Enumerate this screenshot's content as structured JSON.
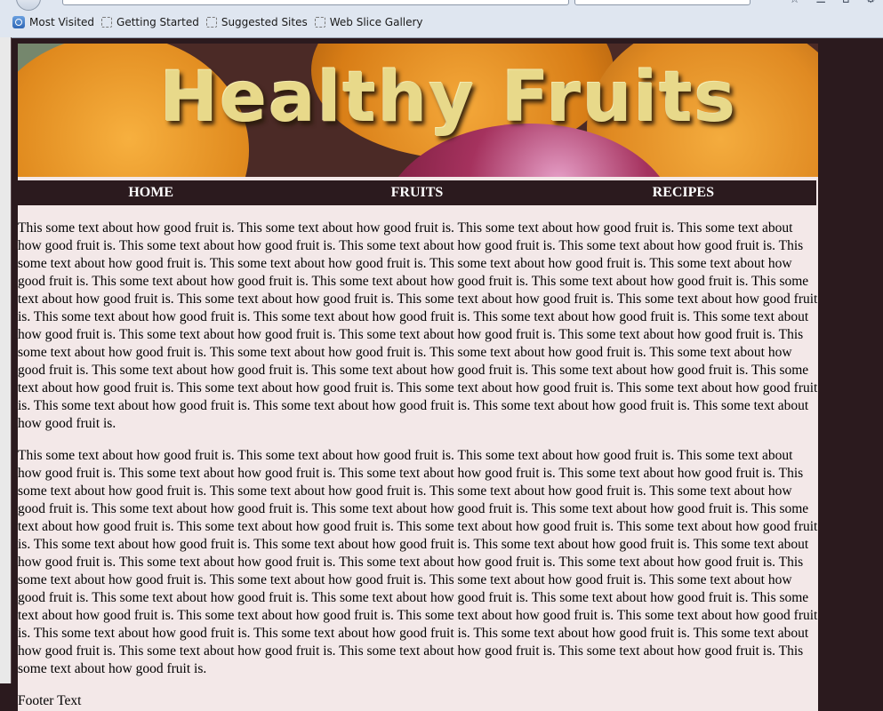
{
  "browser": {
    "bookmarks": [
      "Most Visited",
      "Getting Started",
      "Suggested Sites",
      "Web Slice Gallery"
    ]
  },
  "site": {
    "title": "Healthy Fruits",
    "nav": [
      "HOME",
      "FRUITS",
      "RECIPES"
    ],
    "paragraphs": [
      "This some text about how good fruit is. This some text about how good fruit is. This some text about how good fruit is. This some text about how good fruit is. This some text about how good fruit is. This some text about how good fruit is. This some text about how good fruit is. This some text about how good fruit is. This some text about how good fruit is. This some text about how good fruit is. This some text about how good fruit is. This some text about how good fruit is. This some text about how good fruit is. This some text about how good fruit is. This some text about how good fruit is. This some text about how good fruit is. This some text about how good fruit is. This some text about how good fruit is. This some text about how good fruit is. This some text about how good fruit is. This some text about how good fruit is. This some text about how good fruit is. This some text about how good fruit is. This some text about how good fruit is. This some text about how good fruit is. This some text about how good fruit is. This some text about how good fruit is. This some text about how good fruit is. This some text about how good fruit is. This some text about how good fruit is. This some text about how good fruit is. This some text about how good fruit is. This some text about how good fruit is. This some text about how good fruit is. This some text about how good fruit is. This some text about how good fruit is. This some text about how good fruit is. This some text about how good fruit is. This some text about how good fruit is. This some text about how good fruit is.",
      "This some text about how good fruit is. This some text about how good fruit is. This some text about how good fruit is. This some text about how good fruit is. This some text about how good fruit is. This some text about how good fruit is. This some text about how good fruit is. This some text about how good fruit is. This some text about how good fruit is. This some text about how good fruit is. This some text about how good fruit is. This some text about how good fruit is. This some text about how good fruit is. This some text about how good fruit is. This some text about how good fruit is. This some text about how good fruit is. This some text about how good fruit is. This some text about how good fruit is. This some text about how good fruit is. This some text about how good fruit is. This some text about how good fruit is. This some text about how good fruit is. This some text about how good fruit is. This some text about how good fruit is. This some text about how good fruit is. This some text about how good fruit is. This some text about how good fruit is. This some text about how good fruit is. This some text about how good fruit is. This some text about how good fruit is. This some text about how good fruit is. This some text about how good fruit is. This some text about how good fruit is. This some text about how good fruit is. This some text about how good fruit is. This some text about how good fruit is. This some text about how good fruit is. This some text about how good fruit is. This some text about how good fruit is. This some text about how good fruit is. This some text about how good fruit is. This some text about how good fruit is. This some text about how good fruit is. This some text about how good fruit is."
    ],
    "footer": "Footer Text"
  },
  "colors": {
    "page_background": "#2b1a1e",
    "content_background": "#f3e8e8",
    "nav_background": "#2b1a1e",
    "title_color": "#e8d98a"
  }
}
